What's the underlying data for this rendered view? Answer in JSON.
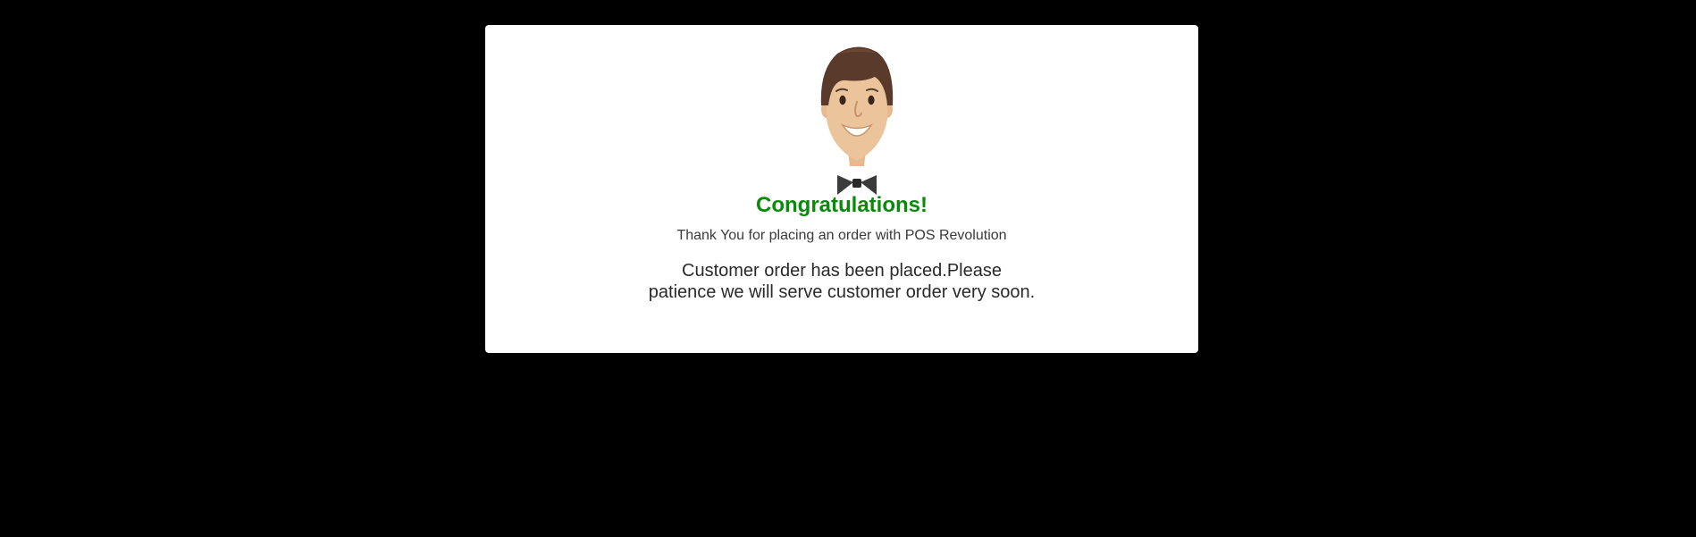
{
  "dialog": {
    "illustration_icon": "waiter-bowtie-icon",
    "title": "Congratulations!",
    "subtitle": "Thank You for placing an order with POS Revolution",
    "message_line1": "Customer order has been placed.Please",
    "message_line2": "patience we will serve customer order very soon."
  },
  "colors": {
    "backdrop": "#000000",
    "dialog_bg": "#ffffff",
    "title": "#0a8a0a",
    "text": "#2a2a2a"
  }
}
